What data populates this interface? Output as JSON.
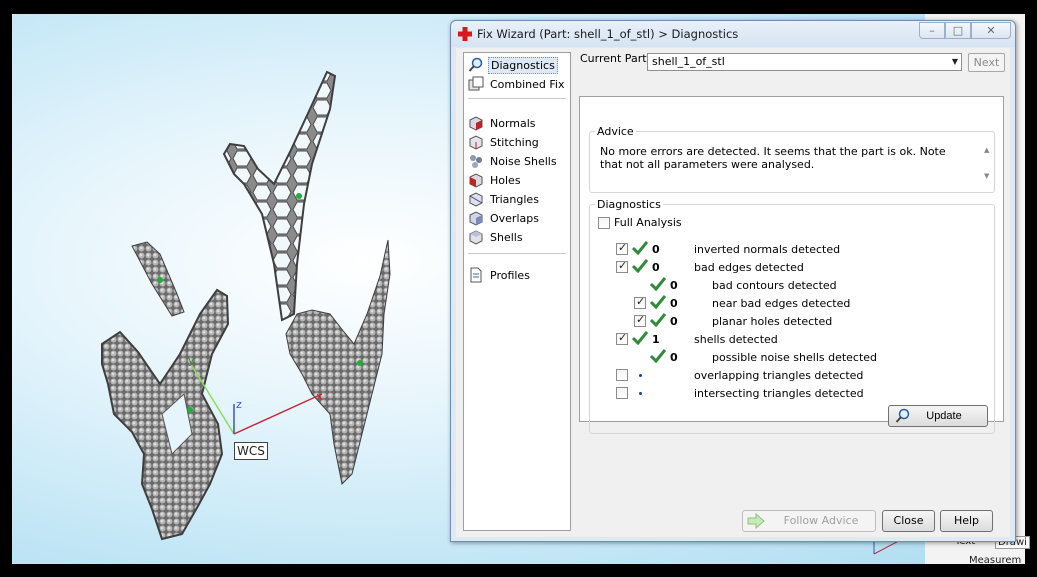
{
  "dialog": {
    "title": "Fix Wizard (Part: shell_1_of_stl) > Diagnostics",
    "window_buttons": {
      "minimize": "–",
      "maximize": "□",
      "close": "✕"
    },
    "current_part_label": "Current Part:",
    "current_part_value": "shell_1_of_stl",
    "next_label": "Next"
  },
  "sidebar": {
    "items": [
      {
        "label": "Diagnostics",
        "icon": "magnifier-icon",
        "selected": true
      },
      {
        "label": "Combined Fix",
        "icon": "combined-fix-icon"
      },
      {
        "label": "Normals",
        "icon": "normals-cube-icon"
      },
      {
        "label": "Stitching",
        "icon": "stitching-cube-icon"
      },
      {
        "label": "Noise Shells",
        "icon": "noise-shells-icon"
      },
      {
        "label": "Holes",
        "icon": "holes-cube-icon"
      },
      {
        "label": "Triangles",
        "icon": "triangles-cube-icon"
      },
      {
        "label": "Overlaps",
        "icon": "overlaps-cube-icon"
      },
      {
        "label": "Shells",
        "icon": "shells-cube-icon"
      },
      {
        "label": "Profiles",
        "icon": "document-icon"
      }
    ]
  },
  "advice": {
    "title": "Advice",
    "text": "No more errors are detected. It seems that the part is ok. Note that not all parameters were analysed."
  },
  "diagnostics": {
    "title": "Diagnostics",
    "full_analysis_label": "Full Analysis",
    "full_analysis_checked": false,
    "rows": [
      {
        "checkbox": true,
        "checked": true,
        "status": "ok",
        "count": "0",
        "label": "inverted normals detected",
        "indent": 0
      },
      {
        "checkbox": true,
        "checked": true,
        "status": "ok",
        "count": "0",
        "label": "bad edges detected",
        "indent": 0
      },
      {
        "checkbox": false,
        "checked": false,
        "status": "ok",
        "count": "0",
        "label": "bad contours detected",
        "indent": 1
      },
      {
        "checkbox": true,
        "checked": true,
        "status": "ok",
        "count": "0",
        "label": "near bad edges detected",
        "indent": 1
      },
      {
        "checkbox": true,
        "checked": true,
        "status": "ok",
        "count": "0",
        "label": "planar holes detected",
        "indent": 1
      },
      {
        "checkbox": true,
        "checked": true,
        "status": "ok",
        "count": "1",
        "label": "shells detected",
        "indent": 0
      },
      {
        "checkbox": false,
        "checked": false,
        "status": "ok",
        "count": "0",
        "label": "possible noise shells detected",
        "indent": 1
      },
      {
        "checkbox": true,
        "checked": false,
        "status": "dot",
        "count": "",
        "label": "overlapping triangles detected",
        "indent": 0
      },
      {
        "checkbox": true,
        "checked": false,
        "status": "dot",
        "count": "",
        "label": "intersecting triangles detected",
        "indent": 0
      }
    ],
    "update_label": "Update"
  },
  "buttons": {
    "follow_advice": "Follow Advice",
    "close": "Close",
    "help": "Help"
  },
  "viewport": {
    "wcs_label": "WCS",
    "axis_x": "x",
    "axis_y": "y",
    "axis_z": "z"
  },
  "background_app": {
    "text_label": "Text",
    "drawing_label": "Drawi",
    "measurement_label": "Measurem"
  },
  "colors": {
    "viewport_bg": "#bfe5f5",
    "check_green": "#2e8b3a",
    "accent_red": "#d7191c",
    "dialog_frame": "#dfe9f5"
  }
}
